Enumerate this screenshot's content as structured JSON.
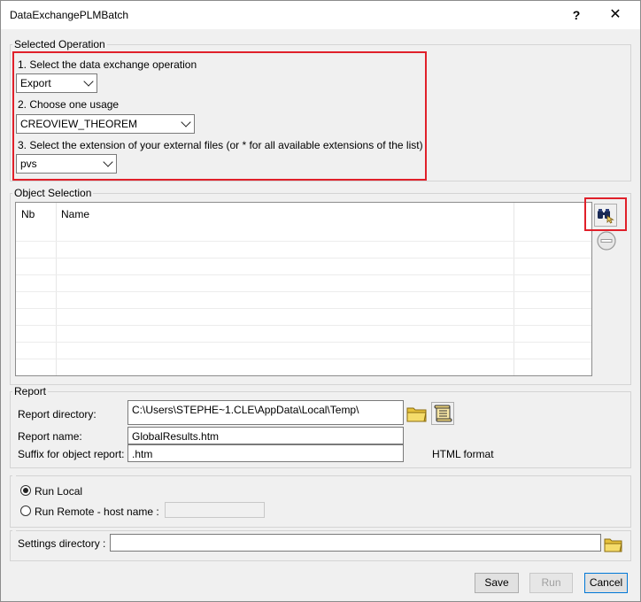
{
  "window": {
    "title": "DataExchangePLMBatch",
    "help_label": "?",
    "close_label": "✕"
  },
  "selected_operation": {
    "legend": "Selected Operation",
    "step1_label": "1. Select the data exchange operation",
    "operation_value": "Export",
    "step2_label": "2. Choose one usage",
    "usage_value": "CREOVIEW_THEOREM",
    "step3_label": "3. Select the extension of your external files (or * for all available extensions of the list)",
    "extension_value": "pvs"
  },
  "object_selection": {
    "legend": "Object Selection",
    "columns": [
      "Nb",
      "Name"
    ],
    "rows": [],
    "search_icon": "binoculars-icon",
    "remove_icon": "remove-circle-icon"
  },
  "report": {
    "legend": "Report",
    "directory_label": "Report directory:",
    "directory_value": "C:\\Users\\STEPHE~1.CLE\\AppData\\Local\\Temp\\",
    "name_label": "Report name:",
    "name_value": "GlobalResults.htm",
    "suffix_label": "Suffix for object report:",
    "suffix_value": ".htm",
    "format_label": "HTML format",
    "browse_icon": "folder-open-icon",
    "view_icon": "scroll-icon"
  },
  "run": {
    "local_label": "Run Local",
    "local_selected": true,
    "remote_label": "Run Remote - host name :",
    "host_value": ""
  },
  "settings": {
    "label": "Settings directory :",
    "value": "",
    "browse_icon": "folder-open-icon"
  },
  "buttons": {
    "save": "Save",
    "run": "Run",
    "cancel": "Cancel"
  },
  "colors": {
    "highlight": "#e0202a",
    "focus": "#0078d7"
  }
}
